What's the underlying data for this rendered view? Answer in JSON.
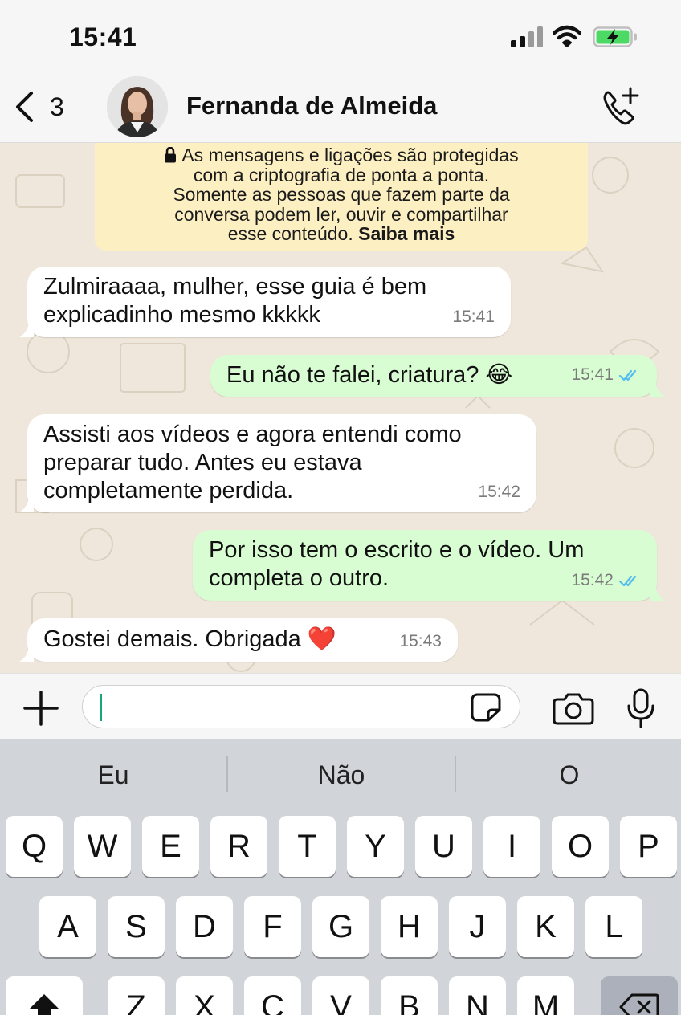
{
  "status_bar": {
    "time": "15:41"
  },
  "header": {
    "back_count": "3",
    "contact_name": "Fernanda de Almeida"
  },
  "notice": {
    "lines": [
      "As mensagens e ligações são protegidas",
      "com a criptografia de ponta a ponta.",
      "Somente as pessoas que fazem parte da",
      "conversa podem ler, ouvir e compartilhar"
    ],
    "last_line": "esse conteúdo.",
    "link": "Saiba mais"
  },
  "messages": [
    {
      "direction": "in",
      "lines": [
        "Zulmiraaaa, mulher, esse guia é bem",
        "explicadinho mesmo kkkkk"
      ],
      "time": "15:41"
    },
    {
      "direction": "out",
      "lines": [
        "Eu não te falei, criatura? 😂"
      ],
      "time": "15:41",
      "read": true
    },
    {
      "direction": "in",
      "lines": [
        "Assisti aos vídeos e agora entendi como",
        "preparar tudo. Antes eu estava",
        "completamente perdida."
      ],
      "time": "15:42"
    },
    {
      "direction": "out",
      "lines": [
        "Por isso tem o escrito e o vídeo. Um",
        "completa o outro."
      ],
      "time": "15:42",
      "read": true
    },
    {
      "direction": "in",
      "lines": [
        "Gostei demais. Obrigada ❤️"
      ],
      "time": "15:43"
    }
  ],
  "composer": {
    "value": ""
  },
  "keyboard": {
    "suggestions": [
      "Eu",
      "Não",
      "O"
    ],
    "row1": [
      "Q",
      "W",
      "E",
      "R",
      "T",
      "Y",
      "U",
      "I",
      "O",
      "P"
    ],
    "row2": [
      "A",
      "S",
      "D",
      "F",
      "G",
      "H",
      "J",
      "K",
      "L"
    ],
    "row3": [
      "Z",
      "X",
      "C",
      "V",
      "B",
      "N",
      "M"
    ]
  },
  "colors": {
    "incoming_bubble": "#ffffff",
    "outgoing_bubble": "#d9fdd3",
    "notice_background": "#fcefc2",
    "read_ticks": "#53bdeb",
    "chat_background": "#efe7db",
    "keyboard_background": "#d1d4d9"
  },
  "icons": [
    "back-chevron-icon",
    "call-add-icon",
    "lock-icon",
    "plus-icon",
    "sticker-icon",
    "camera-icon",
    "microphone-icon",
    "shift-icon",
    "backspace-icon",
    "double-check-icon"
  ]
}
